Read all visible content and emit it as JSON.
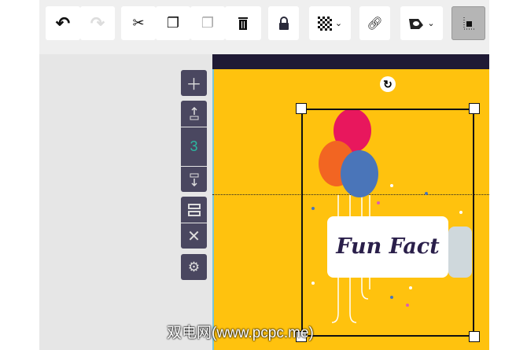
{
  "toolbar": {
    "buttons": [
      {
        "name": "undo",
        "icon": "undo-icon",
        "glyph": "↶"
      },
      {
        "name": "redo",
        "icon": "redo-icon",
        "glyph": "↷",
        "disabled": true
      },
      {
        "name": "cut",
        "icon": "scissors-icon",
        "glyph": "✂"
      },
      {
        "name": "copy",
        "icon": "copy-icon",
        "glyph": "⎘"
      },
      {
        "name": "paste",
        "icon": "paste-icon",
        "glyph": "📋",
        "disabled": true
      },
      {
        "name": "delete",
        "icon": "trash-icon",
        "glyph": "🗑"
      },
      {
        "name": "lock",
        "icon": "lock-icon",
        "glyph": "🔒"
      },
      {
        "name": "transparency",
        "icon": "checkerboard-icon"
      },
      {
        "name": "link",
        "icon": "link-icon",
        "glyph": "🔗"
      },
      {
        "name": "shape",
        "icon": "shape-icon"
      },
      {
        "name": "align",
        "icon": "position-icon"
      }
    ]
  },
  "side": {
    "page_number": "3"
  },
  "card": {
    "text": "Fun Fact"
  },
  "watermark": "双电网(www.pcpc.me)",
  "colors": {
    "canvas": "#ffc20e",
    "side_button": "#4a4760",
    "page_number": "#2bb8a0"
  }
}
